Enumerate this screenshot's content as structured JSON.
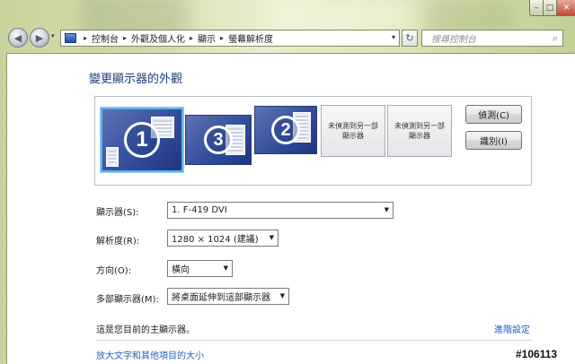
{
  "window": {
    "caption": {
      "minimize": "–",
      "maximize": "□",
      "close": "✕"
    }
  },
  "nav": {
    "back_icon": "arrow-left-icon",
    "forward_icon": "arrow-right-icon",
    "back_glyph": "◀",
    "forward_glyph": "▶",
    "history_glyph": "▾"
  },
  "address": {
    "separator": "▸",
    "crumbs": [
      "控制台",
      "外觀及個人化",
      "顯示",
      "螢幕解析度"
    ],
    "dropdown_glyph": "▾"
  },
  "refresh_glyph": "↻",
  "search": {
    "placeholder": "搜尋控制台",
    "icon_glyph": "⌕"
  },
  "page": {
    "title": "變更顯示器的外觀"
  },
  "monitors": {
    "active": [
      {
        "number": "1",
        "selected": true
      },
      {
        "number": "3",
        "selected": false
      },
      {
        "number": "2",
        "selected": false
      }
    ],
    "not_detected": [
      "未偵測到另一部顯示器",
      "未偵測到另一部顯示器"
    ]
  },
  "buttons": {
    "detect": "偵測(C)",
    "identify": "識別(I)"
  },
  "settings": {
    "display_label": "顯示器(S):",
    "display_value": "1. F-419 DVI",
    "resolution_label": "解析度(R):",
    "resolution_value": "1280 × 1024 (建議)",
    "orientation_label": "方向(O):",
    "orientation_value": "橫向",
    "multi_label": "多部顯示器(M):",
    "multi_value": "將桌面延伸到這部顯示器",
    "dropdown_glyph": "▼"
  },
  "footer": {
    "primary_note": "這是您目前的主顯示器。",
    "advanced_link": "進階設定",
    "text_size_link": "放大文字和其他項目的大小"
  },
  "watermark": "#106113"
}
